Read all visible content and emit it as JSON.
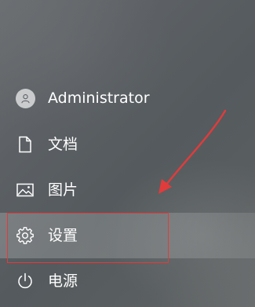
{
  "start_menu": {
    "user": {
      "label": "Administrator",
      "icon": "user-avatar-icon"
    },
    "documents": {
      "label": "文档",
      "icon": "document-icon"
    },
    "pictures": {
      "label": "图片",
      "icon": "picture-icon"
    },
    "settings": {
      "label": "设置",
      "icon": "gear-icon"
    },
    "power": {
      "label": "电源",
      "icon": "power-icon"
    }
  },
  "annotation": {
    "highlight_color": "#e23b3b",
    "target": "settings"
  },
  "colors": {
    "background": "#5c6064",
    "text": "#ffffff",
    "highlight_box": "#e23b3b"
  }
}
